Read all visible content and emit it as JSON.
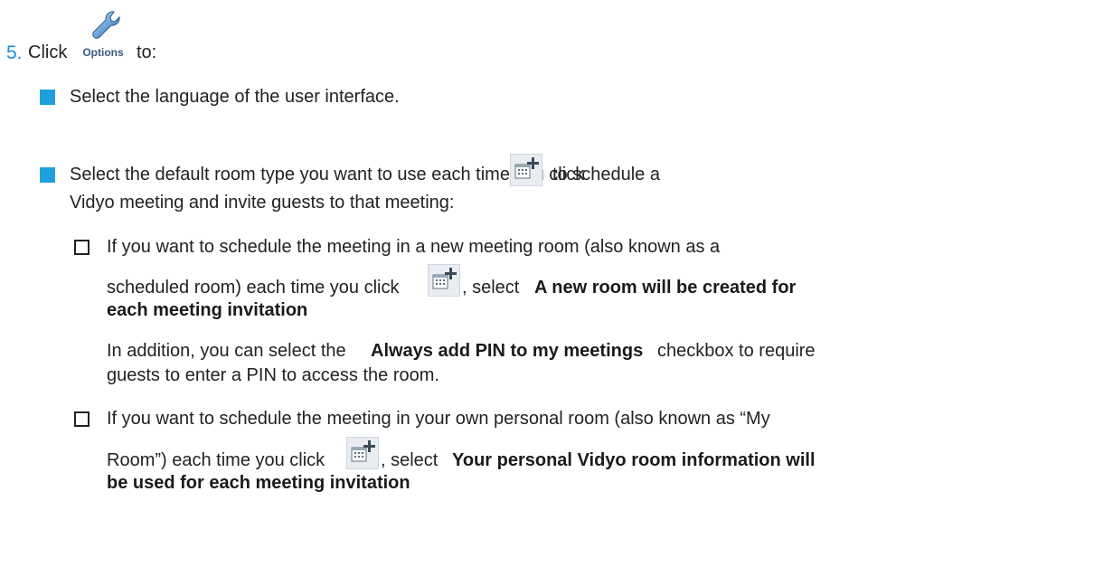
{
  "step": {
    "number": "5.",
    "click": "Click",
    "options_icon_label": "Options",
    "to": "to:"
  },
  "items": {
    "language": "Select the language of the user interface.",
    "room_type_line1": "Select the default room type you want to use each time you click",
    "room_type_line1_end": "to schedule a",
    "room_type_line2": "Vidyo meeting and invite guests to that meeting:"
  },
  "sub_new": {
    "line1": "If you want to schedule the meeting in a new meeting room (also known as a",
    "line2_start": "scheduled room) each time you click",
    "line2_mid": ", select",
    "bold_line2": "A new room will be created for",
    "bold_line3": "each meeting invitation",
    "line3_end": ".",
    "add_line1_start": "In addition, you can select the",
    "add_bold": "Always add PIN to my meetings",
    "add_line1_end": "checkbox to require",
    "add_line2": "guests to enter a PIN to access the room."
  },
  "sub_personal": {
    "line1": "If you want to schedule the meeting in your own personal room (also known as “My",
    "line2_start": "Room”) each time you click",
    "line2_mid": ", select",
    "bold_line2": "Your personal Vidyo room information will",
    "bold_line3": "be used for each meeting invitation",
    "line3_end": "."
  },
  "icons": {
    "options": "wrench-icon",
    "schedule": "calendar-plus-icon"
  }
}
